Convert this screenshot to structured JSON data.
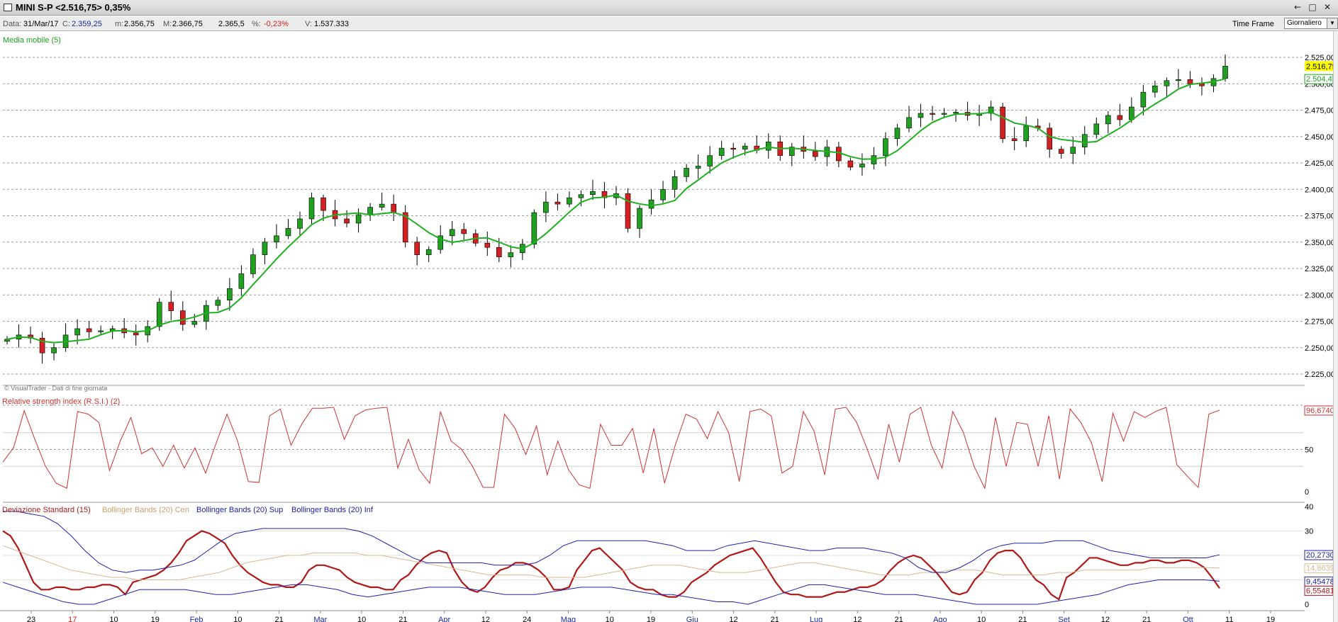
{
  "window": {
    "title": "MINI S-P <2.516,75> 0,35%",
    "buttons": [
      "←",
      "□",
      "✕"
    ]
  },
  "infobar": {
    "data_label": "Data:",
    "data_value": "31/Mar/17",
    "c_label": "C:",
    "c_value": "2.359,25",
    "m_label": "m:",
    "m_value": "2.356,75",
    "M_label": "M:",
    "M_value": "2.366,75",
    "last_value": "2.365,5",
    "pct_label": "%:",
    "pct_value": "-0,23%",
    "v_label": "V:",
    "v_value": "1.537.333",
    "timeframe_label": "Time Frame",
    "timeframe_value": "Giornaliero"
  },
  "chart_data": [
    {
      "type": "candlestick",
      "indicator_label": "Media mobile (5)",
      "watermark": "© VisualTrader - Dati di fine giornata",
      "y_ticks": [
        "2.525,00",
        "2.500,00",
        "2.475,00",
        "2.450,00",
        "2.425,00",
        "2.400,00",
        "2.375,00",
        "2.350,00",
        "2.325,00",
        "2.300,00",
        "2.275,00",
        "2.250,00",
        "2.225,00"
      ],
      "ylim": [
        2220,
        2540
      ],
      "last_price_label": "2.516,75",
      "ma_value_label": "2.504,4",
      "colors": {
        "up": "#1fa01f",
        "down": "#d42020",
        "ma": "#1fb01f",
        "last": "#ffff00"
      },
      "close_path": [
        2258,
        2262,
        2259,
        2245,
        2250,
        2262,
        2268,
        2265,
        2266,
        2268,
        2264,
        2262,
        2270,
        2293,
        2285,
        2272,
        2275,
        2290,
        2295,
        2306,
        2320,
        2338,
        2350,
        2356,
        2363,
        2372,
        2392,
        2380,
        2372,
        2368,
        2376,
        2383,
        2386,
        2378,
        2350,
        2338,
        2343,
        2356,
        2362,
        2358,
        2349,
        2345,
        2336,
        2340,
        2348,
        2378,
        2388,
        2386,
        2392,
        2395,
        2398,
        2392,
        2396,
        2363,
        2382,
        2390,
        2400,
        2412,
        2420,
        2422,
        2432,
        2439,
        2438,
        2441,
        2437,
        2445,
        2432,
        2440,
        2436,
        2431,
        2440,
        2427,
        2421,
        2424,
        2432,
        2448,
        2458,
        2468,
        2472,
        2471,
        2472,
        2473,
        2470,
        2472,
        2478,
        2448,
        2446,
        2460,
        2458,
        2438,
        2434,
        2440,
        2452,
        2462,
        2470,
        2466,
        2478,
        2492,
        2498,
        2503,
        2504,
        2500,
        2498,
        2505,
        2516.75
      ]
    },
    {
      "type": "line",
      "indicator_label": "Relative strength index (R.S.I.) (2)",
      "y_ticks": [
        "50",
        "0"
      ],
      "ylim": [
        0,
        100
      ],
      "last_value_label": "96,6740",
      "color": "#cc3333",
      "values": [
        35,
        52,
        96,
        62,
        30,
        10,
        4,
        95,
        92,
        82,
        25,
        60,
        88,
        45,
        52,
        30,
        55,
        28,
        52,
        22,
        58,
        92,
        60,
        12,
        11,
        90,
        98,
        55,
        80,
        99,
        99,
        100,
        62,
        90,
        97,
        99,
        100,
        28,
        62,
        26,
        10,
        95,
        60,
        50,
        30,
        5,
        5,
        92,
        75,
        44,
        78,
        20,
        60,
        26,
        8,
        4,
        80,
        55,
        55,
        75,
        22,
        75,
        10,
        55,
        92,
        86,
        63,
        95,
        70,
        12,
        95,
        98,
        90,
        22,
        30,
        95,
        72,
        20,
        98,
        100,
        82,
        50,
        15,
        80,
        35,
        92,
        100,
        55,
        28,
        95,
        70,
        30,
        4,
        88,
        30,
        82,
        80,
        30,
        90,
        15,
        98,
        82,
        58,
        12,
        93,
        60,
        95,
        88,
        95,
        100,
        32,
        18,
        5,
        92,
        96.674
      ]
    },
    {
      "type": "line",
      "y_ticks": [
        "40",
        "30",
        "20",
        "10",
        "0"
      ],
      "ylim": [
        0,
        40
      ],
      "series": [
        {
          "name": "Deviazione Standard (15)",
          "color": "#b01818",
          "last_label": "6,55481",
          "values": [
            30,
            28,
            23,
            16,
            9,
            6,
            6,
            7,
            7,
            6,
            6,
            7,
            7,
            8,
            8,
            7,
            4,
            9,
            10,
            11,
            12,
            14,
            17,
            21,
            26,
            28,
            30,
            29,
            27,
            25,
            20,
            16,
            13,
            11,
            9,
            8,
            8,
            7,
            7,
            9,
            14,
            16,
            16,
            15,
            14,
            11,
            9,
            8,
            7,
            7,
            6,
            6,
            10,
            12,
            16,
            19,
            21,
            22,
            21,
            14,
            9,
            6,
            5,
            7,
            11,
            14,
            15,
            17,
            17,
            16,
            14,
            11,
            6,
            6,
            7,
            14,
            18,
            22,
            23,
            20,
            17,
            14,
            9,
            7,
            6,
            6,
            4,
            3,
            3,
            5,
            9,
            11,
            13,
            16,
            18,
            20,
            21,
            22,
            23,
            19,
            14,
            9,
            5,
            4,
            4,
            3,
            3,
            3,
            4,
            5,
            5,
            6,
            7,
            7,
            8,
            10,
            14,
            17,
            19,
            20,
            19,
            16,
            13,
            9,
            5,
            4,
            5,
            10,
            13,
            18,
            21,
            22,
            22,
            19,
            14,
            10,
            8,
            4,
            2,
            11,
            13,
            16,
            19,
            19,
            18,
            17,
            16,
            16,
            17,
            17,
            18,
            18,
            17,
            17,
            18,
            18,
            17,
            15,
            11,
            6.55481
          ]
        },
        {
          "name": "Bollinger Bands (20) Cen",
          "color": "#d8b890",
          "last_label": "14,8639",
          "values": [
            24,
            22,
            20,
            18,
            16,
            14,
            13,
            12,
            11,
            11,
            10,
            10,
            10,
            10,
            11,
            12,
            13,
            15,
            17,
            18,
            19,
            20,
            20,
            21,
            21,
            21,
            21,
            20,
            20,
            19,
            18,
            17,
            16,
            15,
            14,
            13,
            12,
            12,
            12,
            12,
            11,
            11,
            11,
            11,
            12,
            13,
            14,
            15,
            16,
            16,
            16,
            15,
            14,
            13,
            13,
            13,
            14,
            15,
            16,
            17,
            17,
            16,
            15,
            14,
            13,
            12,
            12,
            12,
            13,
            13,
            14,
            14,
            14,
            13,
            12,
            12,
            12,
            12,
            13,
            13,
            14,
            14,
            14,
            14,
            14,
            15,
            15,
            15,
            15,
            15,
            14.8639
          ]
        },
        {
          "name": "Bollinger Bands (20) Sup",
          "color": "#2020a8",
          "last_label": "20,2730",
          "values": [
            38,
            38,
            37,
            36,
            33,
            28,
            22,
            17,
            14,
            13,
            14,
            14,
            15,
            16,
            18,
            22,
            26,
            29,
            30,
            31,
            31,
            31,
            31,
            31,
            31,
            31,
            30,
            28,
            25,
            22,
            19,
            17,
            17,
            17,
            17,
            17,
            16,
            16,
            16,
            17,
            20,
            24,
            26,
            26,
            26,
            26,
            26,
            26,
            25,
            24,
            22,
            22,
            22,
            24,
            25,
            26,
            25,
            24,
            23,
            22,
            22,
            23,
            23,
            23,
            22,
            21,
            19,
            15,
            13,
            13,
            15,
            18,
            22,
            24,
            25,
            25,
            25,
            26,
            26,
            26,
            24,
            22,
            21,
            20,
            19,
            19,
            19,
            19,
            19,
            20.273
          ]
        },
        {
          "name": "Bollinger Bands (20) Inf",
          "color": "#2020a8",
          "last_label": "9,45478",
          "values": [
            9,
            7,
            5,
            3,
            1,
            0,
            0,
            2,
            4,
            6,
            6,
            6,
            6,
            5,
            4,
            4,
            5,
            6,
            7,
            8,
            8,
            7,
            6,
            4,
            3,
            4,
            5,
            6,
            7,
            7,
            7,
            6,
            5,
            4,
            4,
            4,
            5,
            6,
            7,
            7,
            7,
            6,
            5,
            4,
            4,
            3,
            2,
            1,
            1,
            0,
            2,
            4,
            6,
            8,
            8,
            7,
            6,
            5,
            4,
            4,
            4,
            3,
            2,
            1,
            0,
            0,
            0,
            0,
            0,
            1,
            2,
            3,
            4,
            6,
            8,
            9,
            10,
            10,
            10,
            10,
            9.45478
          ]
        }
      ]
    }
  ],
  "x_axis": {
    "labels": [
      {
        "text": "23",
        "color": "#000"
      },
      {
        "text": "17",
        "color": "#d42020"
      },
      {
        "text": "10",
        "color": "#000"
      },
      {
        "text": "19",
        "color": "#000"
      },
      {
        "text": "Feb",
        "color": "#1a2aa0"
      },
      {
        "text": "10",
        "color": "#000"
      },
      {
        "text": "21",
        "color": "#000"
      },
      {
        "text": "Mar",
        "color": "#1a2aa0"
      },
      {
        "text": "10",
        "color": "#000"
      },
      {
        "text": "21",
        "color": "#000"
      },
      {
        "text": "Apr",
        "color": "#1a2aa0"
      },
      {
        "text": "12",
        "color": "#000"
      },
      {
        "text": "24",
        "color": "#000"
      },
      {
        "text": "Mag",
        "color": "#1a2aa0"
      },
      {
        "text": "10",
        "color": "#000"
      },
      {
        "text": "19",
        "color": "#000"
      },
      {
        "text": "Giu",
        "color": "#1a2aa0"
      },
      {
        "text": "12",
        "color": "#000"
      },
      {
        "text": "21",
        "color": "#000"
      },
      {
        "text": "Lug",
        "color": "#1a2aa0"
      },
      {
        "text": "12",
        "color": "#000"
      },
      {
        "text": "21",
        "color": "#000"
      },
      {
        "text": "Ago",
        "color": "#1a2aa0"
      },
      {
        "text": "10",
        "color": "#000"
      },
      {
        "text": "21",
        "color": "#000"
      },
      {
        "text": "Set",
        "color": "#1a2aa0"
      },
      {
        "text": "12",
        "color": "#000"
      },
      {
        "text": "21",
        "color": "#000"
      },
      {
        "text": "Ott",
        "color": "#1a2aa0"
      },
      {
        "text": "11",
        "color": "#000"
      },
      {
        "text": "19",
        "color": "#000"
      }
    ]
  }
}
